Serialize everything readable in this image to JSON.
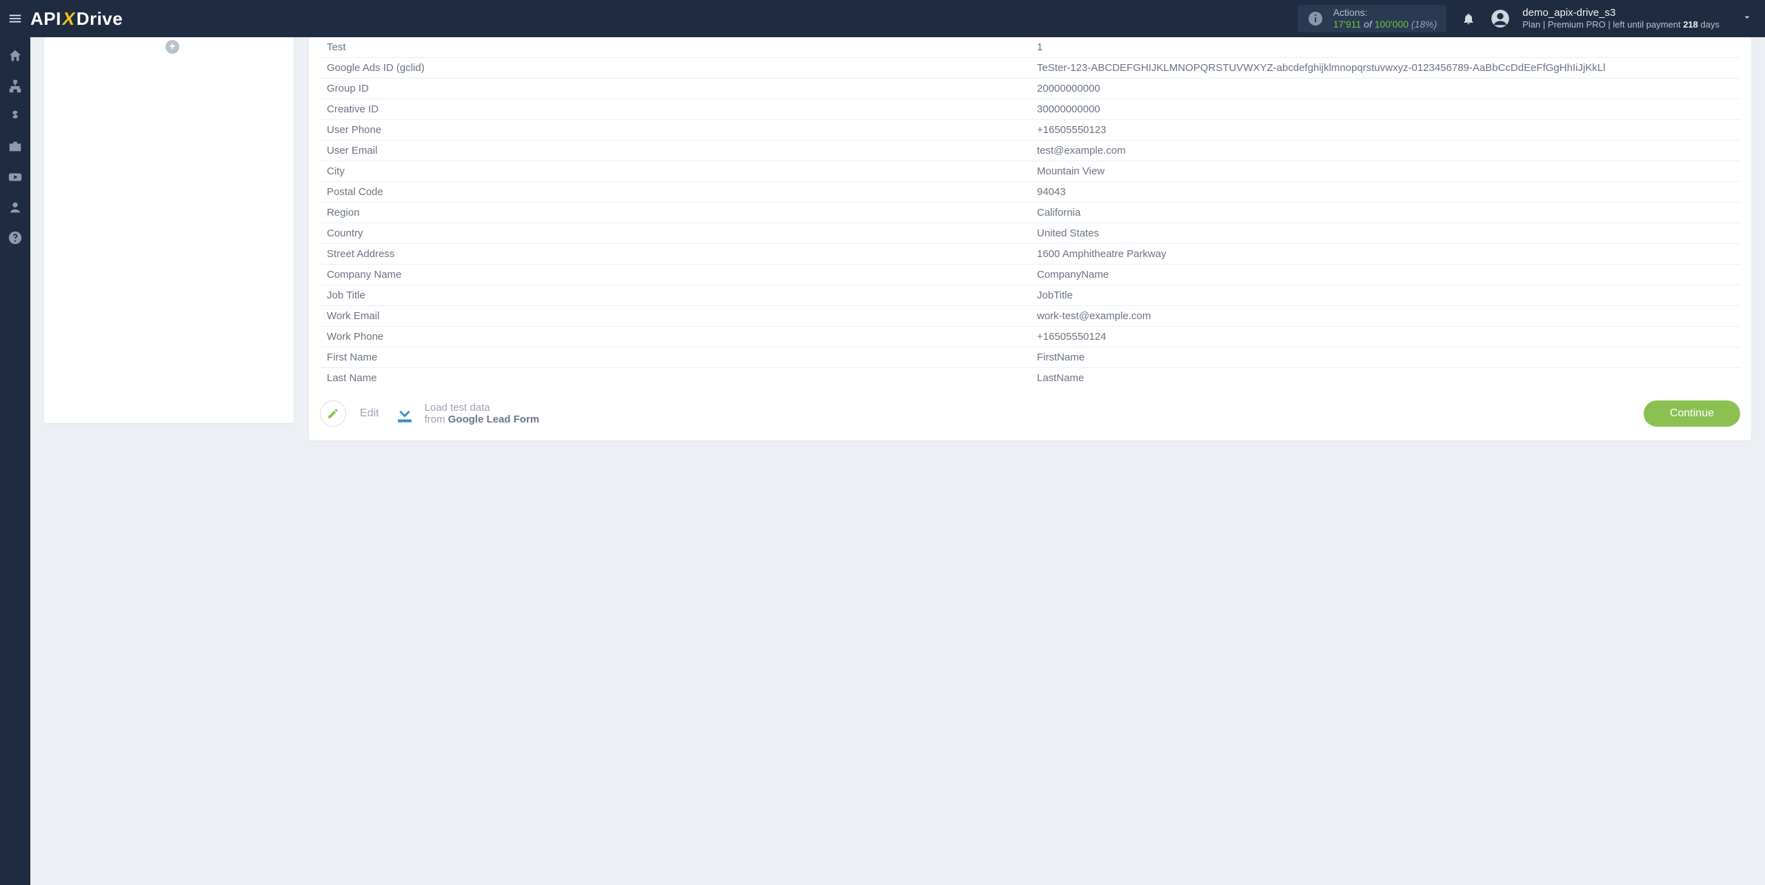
{
  "header": {
    "brand_left": "API",
    "brand_x": "X",
    "brand_right": "Drive",
    "actions_label": "Actions:",
    "actions_used": "17'911",
    "actions_of": " of ",
    "actions_total": "100'000",
    "actions_pct": "(18%)",
    "user_name": "demo_apix-drive_s3",
    "plan_prefix": "Plan |",
    "plan_name": "Premium PRO",
    "plan_mid": "| left until payment ",
    "plan_days_num": "218",
    "plan_days_word": " days"
  },
  "rail": {
    "items": [
      "home-icon",
      "hierarchy-icon",
      "dollar-icon",
      "briefcase-icon",
      "youtube-icon",
      "user-icon",
      "help-icon"
    ]
  },
  "leftcard": {
    "plus": "+"
  },
  "table_rows": [
    {
      "k": "Test",
      "v": "1"
    },
    {
      "k": "Google Ads ID (gclid)",
      "v": "TeSter-123-ABCDEFGHIJKLMNOPQRSTUVWXYZ-abcdefghijklmnopqrstuvwxyz-0123456789-AaBbCcDdEeFfGgHhIiJjKkLl"
    },
    {
      "k": "Group ID",
      "v": "20000000000"
    },
    {
      "k": "Creative ID",
      "v": "30000000000"
    },
    {
      "k": "User Phone",
      "v": "+16505550123"
    },
    {
      "k": "User Email",
      "v": "test@example.com"
    },
    {
      "k": "City",
      "v": "Mountain View"
    },
    {
      "k": "Postal Code",
      "v": "94043"
    },
    {
      "k": "Region",
      "v": "California"
    },
    {
      "k": "Country",
      "v": "United States"
    },
    {
      "k": "Street Address",
      "v": "1600 Amphitheatre Parkway"
    },
    {
      "k": "Company Name",
      "v": "CompanyName"
    },
    {
      "k": "Job Title",
      "v": "JobTitle"
    },
    {
      "k": "Work Email",
      "v": "work-test@example.com"
    },
    {
      "k": "Work Phone",
      "v": "+16505550124"
    },
    {
      "k": "First Name",
      "v": "FirstName"
    },
    {
      "k": "Last Name",
      "v": "LastName"
    }
  ],
  "footer": {
    "edit": "Edit",
    "load_ln1": "Load test data",
    "load_ln2_from": "from ",
    "load_ln2_source": "Google Lead Form",
    "continue": "Continue"
  }
}
